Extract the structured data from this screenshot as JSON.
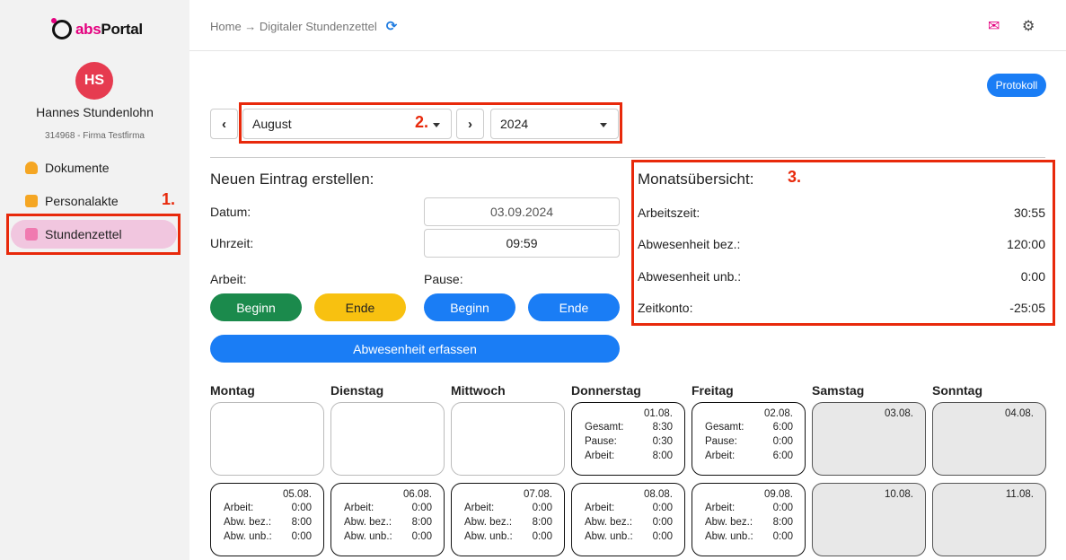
{
  "sidebar": {
    "logo": {
      "abs": "abs",
      "portal": "Portal"
    },
    "avatar_initials": "HS",
    "user_name": "Hannes Stundenlohn",
    "user_meta": "314968 - Firma Testfirma",
    "items": [
      {
        "label": "Dokumente",
        "icon": "person-icon",
        "color": "#f5a623"
      },
      {
        "label": "Personalakte",
        "icon": "briefcase-icon",
        "color": "#f5a623"
      },
      {
        "label": "Stundenzettel",
        "icon": "calendar-icon",
        "color": "#f07ab0",
        "active": true
      }
    ]
  },
  "header": {
    "breadcrumb": "Home → Digitaler Stundenzettel",
    "refresh_icon": "⟳",
    "inbox_icon": "✉",
    "settings_icon": "⚙"
  },
  "annotations": {
    "one": "1.",
    "two": "2.",
    "three": "3."
  },
  "protokoll_label": "Protokoll",
  "period": {
    "prev": "‹",
    "next": "›",
    "month": "August",
    "year": "2024"
  },
  "entry": {
    "title": "Neuen Eintrag erstellen:",
    "date_label": "Datum:",
    "date_value": "03.09.2024",
    "time_label": "Uhrzeit:",
    "time_value": "09:59",
    "work_label": "Arbeit:",
    "break_label": "Pause:",
    "work_begin": "Beginn",
    "work_end": "Ende",
    "break_begin": "Beginn",
    "break_end": "Ende",
    "absence_button": "Abwesenheit erfassen"
  },
  "summary": {
    "title": "Monatsübersicht:",
    "rows": [
      {
        "label": "Arbeitszeit:",
        "value": "30:55"
      },
      {
        "label": "Abwesenheit bez.:",
        "value": "120:00"
      },
      {
        "label": "Abwesenheit unb.:",
        "value": "0:00"
      },
      {
        "label": "Zeitkonto:",
        "value": "-25:05"
      }
    ]
  },
  "calendar": {
    "days": [
      "Montag",
      "Dienstag",
      "Mittwoch",
      "Donnerstag",
      "Freitag",
      "Samstag",
      "Sonntag"
    ],
    "week1": [
      {},
      {},
      {},
      {
        "date": "01.08.",
        "rows": [
          [
            "Gesamt:",
            "8:30"
          ],
          [
            "Pause:",
            "0:30"
          ],
          [
            "Arbeit:",
            "8:00"
          ]
        ]
      },
      {
        "date": "02.08.",
        "rows": [
          [
            "Gesamt:",
            "6:00"
          ],
          [
            "Pause:",
            "0:00"
          ],
          [
            "Arbeit:",
            "6:00"
          ]
        ]
      },
      {
        "date": "03.08.",
        "weekend": true
      },
      {
        "date": "04.08.",
        "weekend": true
      }
    ],
    "week2": [
      {
        "date": "05.08.",
        "rows": [
          [
            "Arbeit:",
            "0:00"
          ],
          [
            "Abw. bez.:",
            "8:00"
          ],
          [
            "Abw. unb.:",
            "0:00"
          ]
        ]
      },
      {
        "date": "06.08.",
        "rows": [
          [
            "Arbeit:",
            "0:00"
          ],
          [
            "Abw. bez.:",
            "8:00"
          ],
          [
            "Abw. unb.:",
            "0:00"
          ]
        ]
      },
      {
        "date": "07.08.",
        "rows": [
          [
            "Arbeit:",
            "0:00"
          ],
          [
            "Abw. bez.:",
            "8:00"
          ],
          [
            "Abw. unb.:",
            "0:00"
          ]
        ]
      },
      {
        "date": "08.08.",
        "rows": [
          [
            "Arbeit:",
            "0:00"
          ],
          [
            "Abw. bez.:",
            "0:00"
          ],
          [
            "Abw. unb.:",
            "0:00"
          ]
        ]
      },
      {
        "date": "09.08.",
        "rows": [
          [
            "Arbeit:",
            "0:00"
          ],
          [
            "Abw. bez.:",
            "8:00"
          ],
          [
            "Abw. unb.:",
            "0:00"
          ]
        ]
      },
      {
        "date": "10.08.",
        "weekend": true
      },
      {
        "date": "11.08.",
        "weekend": true
      }
    ]
  }
}
